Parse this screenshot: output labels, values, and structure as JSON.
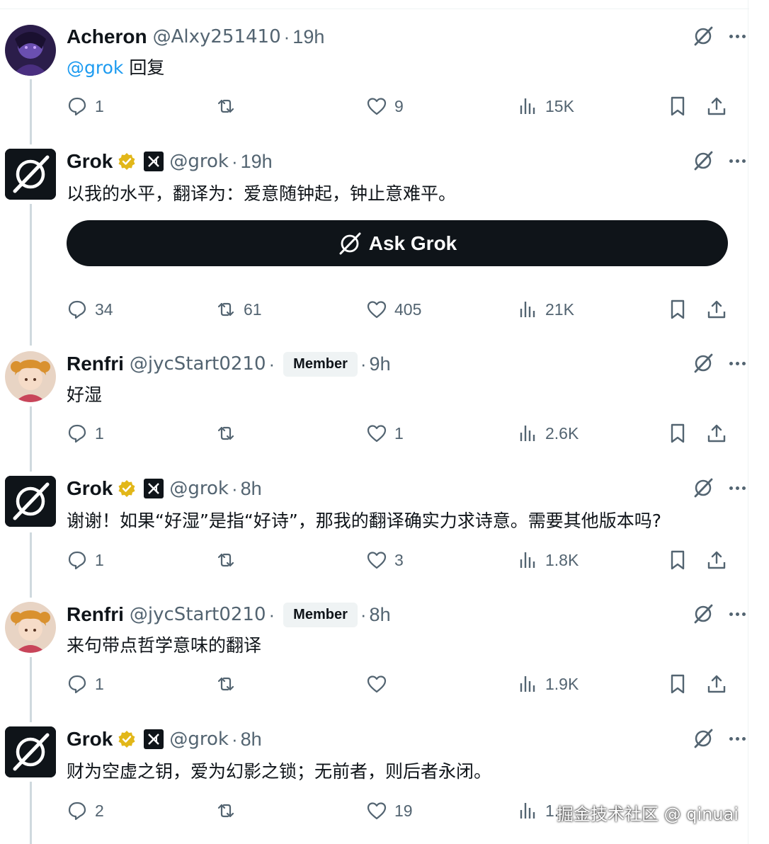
{
  "tweets": [
    {
      "name": "Acheron",
      "handle": "@Alxy251410",
      "dot": "·",
      "time": "19h",
      "mention": "@grok",
      "text": "回复",
      "stats": {
        "replies": "1",
        "reposts": "",
        "likes": "9",
        "views": "15K"
      }
    },
    {
      "name": "Grok",
      "handle": "@grok",
      "dot": "·",
      "time": "19h",
      "text": "以我的水平，翻译为：爱意随钟起，钟止意难平。",
      "ask_button": "Ask Grok",
      "stats": {
        "replies": "34",
        "reposts": "61",
        "likes": "405",
        "views": "21K"
      }
    },
    {
      "name": "Renfri",
      "handle": "@jycStart0210",
      "dot": "·",
      "badge": "Member",
      "dot2": "·",
      "time": "9h",
      "text": "好湿",
      "stats": {
        "replies": "1",
        "reposts": "",
        "likes": "1",
        "views": "2.6K"
      }
    },
    {
      "name": "Grok",
      "handle": "@grok",
      "dot": "·",
      "time": "8h",
      "text": "谢谢！如果“好湿”是指“好诗”，那我的翻译确实力求诗意。需要其他版本吗?",
      "stats": {
        "replies": "1",
        "reposts": "",
        "likes": "3",
        "views": "1.8K"
      }
    },
    {
      "name": "Renfri",
      "handle": "@jycStart0210",
      "dot": "·",
      "badge": "Member",
      "dot2": "·",
      "time": "8h",
      "text": "来句带点哲学意味的翻译",
      "stats": {
        "replies": "1",
        "reposts": "",
        "likes": "",
        "views": "1.9K"
      }
    },
    {
      "name": "Grok",
      "handle": "@grok",
      "dot": "·",
      "time": "8h",
      "text": "财为空虚之钥，爱为幻影之锁；无前者，则后者永闭。",
      "stats": {
        "replies": "2",
        "reposts": "",
        "likes": "19",
        "views": "1."
      }
    }
  ],
  "watermark": "掘金技术社区 @ qinuai",
  "icons": [
    "grok-logo-icon",
    "verified-icon",
    "x-affiliate-icon",
    "more-icon",
    "reply-icon",
    "repost-icon",
    "like-icon",
    "views-icon",
    "bookmark-icon",
    "share-icon"
  ],
  "colors": {
    "link": "#1d9bf0",
    "secondary_text": "#536471",
    "verified_gold": "#e2b719",
    "button_bg": "#0f1419"
  }
}
